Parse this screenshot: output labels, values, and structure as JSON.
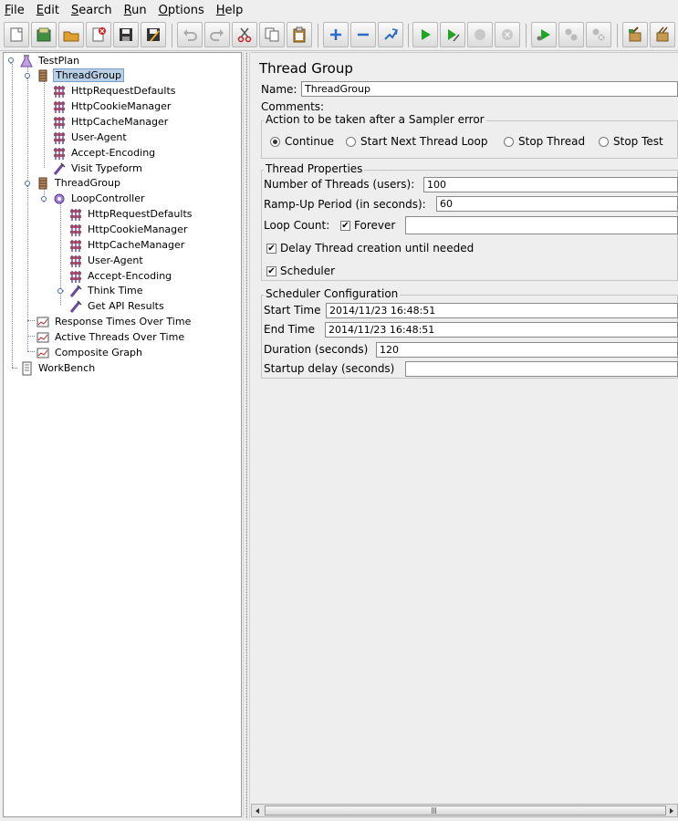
{
  "menu": [
    "File",
    "Edit",
    "Search",
    "Run",
    "Options",
    "Help"
  ],
  "menu_mnemonic": [
    "F",
    "E",
    "S",
    "R",
    "O",
    "H"
  ],
  "toolbar": {
    "buttons": [
      "new-icon",
      "templates-icon",
      "open-icon",
      "close-icon",
      "save-icon",
      "save-as-icon",
      "undo-icon",
      "redo-icon",
      "cut-icon",
      "copy-icon",
      "paste-icon",
      "expand-icon",
      "collapse-icon",
      "toggle-icon",
      "start-icon",
      "start-no-pauses-icon",
      "stop-icon",
      "shutdown-icon",
      "remote-start-icon",
      "remote-stop-icon",
      "remote-shutdown-icon",
      "clear-icon",
      "clear-all-icon"
    ]
  },
  "tree": {
    "nodes": [
      {
        "label": "TestPlan",
        "icon": "testplan-icon",
        "level": 0
      },
      {
        "label": "ThreadGroup",
        "icon": "threadgroup-icon",
        "level": 1,
        "selected": true
      },
      {
        "label": "HttpRequestDefaults",
        "icon": "config-icon",
        "level": 2
      },
      {
        "label": "HttpCookieManager",
        "icon": "config-icon",
        "level": 2
      },
      {
        "label": "HttpCacheManager",
        "icon": "config-icon",
        "level": 2
      },
      {
        "label": "User-Agent",
        "icon": "config-icon",
        "level": 2
      },
      {
        "label": "Accept-Encoding",
        "icon": "config-icon",
        "level": 2
      },
      {
        "label": "Visit Typeform",
        "icon": "sampler-icon",
        "level": 2
      },
      {
        "label": "ThreadGroup",
        "icon": "threadgroup-icon",
        "level": 1
      },
      {
        "label": "LoopController",
        "icon": "controller-icon",
        "level": 2
      },
      {
        "label": "HttpRequestDefaults",
        "icon": "config-icon",
        "level": 3
      },
      {
        "label": "HttpCookieManager",
        "icon": "config-icon",
        "level": 3
      },
      {
        "label": "HttpCacheManager",
        "icon": "config-icon",
        "level": 3
      },
      {
        "label": "User-Agent",
        "icon": "config-icon",
        "level": 3
      },
      {
        "label": "Accept-Encoding",
        "icon": "config-icon",
        "level": 3
      },
      {
        "label": "Think Time",
        "icon": "sampler-icon",
        "level": 3
      },
      {
        "label": "Get API Results",
        "icon": "sampler-icon",
        "level": 3
      },
      {
        "label": "Response Times Over Time",
        "icon": "graph-icon",
        "level": 1
      },
      {
        "label": "Active Threads Over Time",
        "icon": "graph-icon",
        "level": 1
      },
      {
        "label": "Composite Graph",
        "icon": "graph-icon",
        "level": 1
      },
      {
        "label": "WorkBench",
        "icon": "workbench-icon",
        "level": 0
      }
    ]
  },
  "panel": {
    "title": "Thread Group",
    "name_label": "Name:",
    "name_value": "ThreadGroup",
    "comments_label": "Comments:",
    "sampler_error": {
      "title": "Action to be taken after a Sampler error",
      "options": [
        "Continue",
        "Start Next Thread Loop",
        "Stop Thread",
        "Stop Test"
      ],
      "selected": "Continue"
    },
    "thread_properties": {
      "title": "Thread Properties",
      "threads_label": "Number of Threads (users):",
      "threads_value": "100",
      "rampup_label": "Ramp-Up Period (in seconds):",
      "rampup_value": "60",
      "loop_label": "Loop Count:",
      "forever_label": "Forever",
      "forever_checked": true,
      "loop_value": "",
      "delay_label": "Delay Thread creation until needed",
      "delay_checked": true,
      "scheduler_label": "Scheduler",
      "scheduler_checked": true
    },
    "scheduler": {
      "title": "Scheduler Configuration",
      "start_label": "Start Time",
      "start_value": "2014/11/23 16:48:51",
      "end_label": "End Time",
      "end_value": "2014/11/23 16:48:51",
      "duration_label": "Duration (seconds)",
      "duration_value": "120",
      "delay_label": "Startup delay (seconds)",
      "delay_value": ""
    }
  },
  "colors": {
    "selection_bg": "#b8cfe5",
    "window_bg": "#eeeeee",
    "run_green": "#1fa51f"
  }
}
